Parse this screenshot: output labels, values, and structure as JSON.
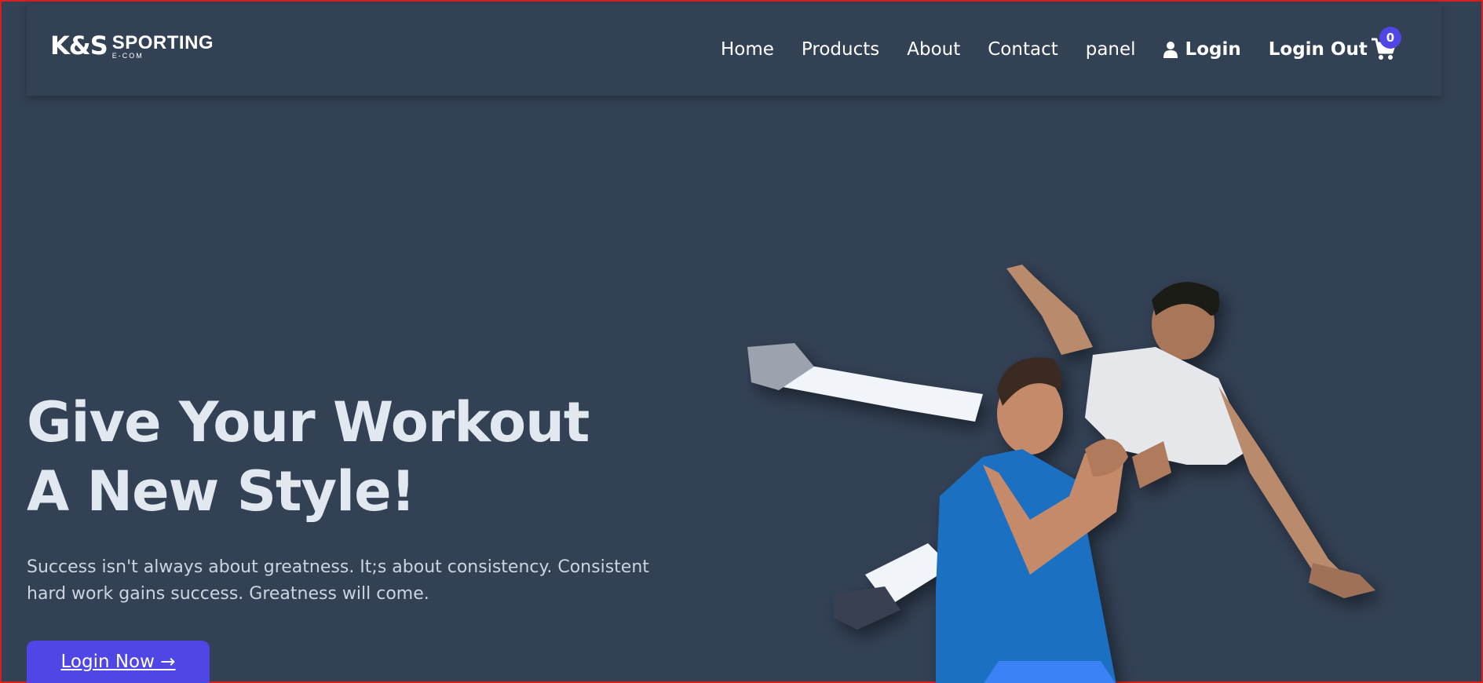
{
  "brand": {
    "logo_main": "K&S",
    "logo_word": "SPORTING",
    "logo_sub": "E-COM"
  },
  "nav": {
    "links": [
      "Home",
      "Products",
      "About",
      "Contact",
      "panel"
    ],
    "login_label": "Login",
    "logout_label": "Login Out",
    "cart_count": "0"
  },
  "hero": {
    "title_line1": "Give Your Workout",
    "title_line2": "A New Style!",
    "text": "Success isn't always about greatness. It;s about consistency. Consistent hard work gains success. Greatness will come.",
    "cta_label": "Login Now →"
  },
  "icons": {
    "user": "user-icon",
    "cart": "shopping-cart-icon"
  },
  "colors": {
    "background": "#334155",
    "accent": "#4f46e5",
    "text": "#e2e8f0"
  }
}
